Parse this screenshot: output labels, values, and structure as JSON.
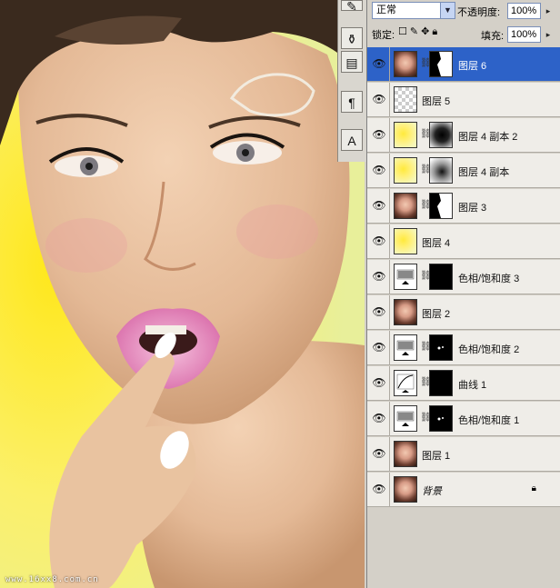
{
  "watermark": "www.16xx8.com.cn",
  "toolstrip": {
    "buttons": [
      {
        "name": "brush-tool-icon"
      },
      {
        "name": "clone-stamp-icon"
      },
      {
        "name": "history-brush-icon"
      },
      {
        "name": "paragraph-icon",
        "glyph": "¶"
      },
      {
        "name": "character-icon",
        "glyph": "A"
      }
    ]
  },
  "panel": {
    "blend_mode": "正常",
    "opacity_label": "不透明度:",
    "opacity_value": "100%",
    "lock_label": "锁定:",
    "fill_label": "填充:",
    "fill_value": "100%",
    "layers": [
      {
        "name": "图层 6",
        "thumb": "face",
        "mask": "white-shape",
        "selected": true
      },
      {
        "name": "图层 5",
        "thumb": "checker",
        "mask": null,
        "selected": false
      },
      {
        "name": "图层 4 副本 2",
        "thumb": "yellow",
        "mask": "dark-blur",
        "selected": false
      },
      {
        "name": "图层 4 副本",
        "thumb": "yellow",
        "mask": "light-blur",
        "selected": false
      },
      {
        "name": "图层 3",
        "thumb": "face",
        "mask": "white-shape",
        "selected": false
      },
      {
        "name": "图层 4",
        "thumb": "yellow",
        "mask": null,
        "selected": false
      },
      {
        "name": "色相/饱和度 3",
        "thumb": "adjust",
        "mask": "black",
        "selected": false
      },
      {
        "name": "图层 2",
        "thumb": "face",
        "mask": null,
        "selected": false
      },
      {
        "name": "色相/饱和度 2",
        "thumb": "adjust",
        "mask": "black-dots",
        "selected": false
      },
      {
        "name": "曲线 1",
        "thumb": "curves",
        "mask": "black",
        "selected": false
      },
      {
        "name": "色相/饱和度 1",
        "thumb": "adjust",
        "mask": "black-dots",
        "selected": false
      },
      {
        "name": "图层 1",
        "thumb": "face",
        "mask": null,
        "selected": false
      },
      {
        "name": "背景",
        "thumb": "face",
        "mask": null,
        "selected": false,
        "locked": true
      }
    ]
  },
  "colors": {
    "selection": "#2d62c8",
    "background_yellow": "#f4f06a",
    "lip_pink": "#e07bb5"
  }
}
